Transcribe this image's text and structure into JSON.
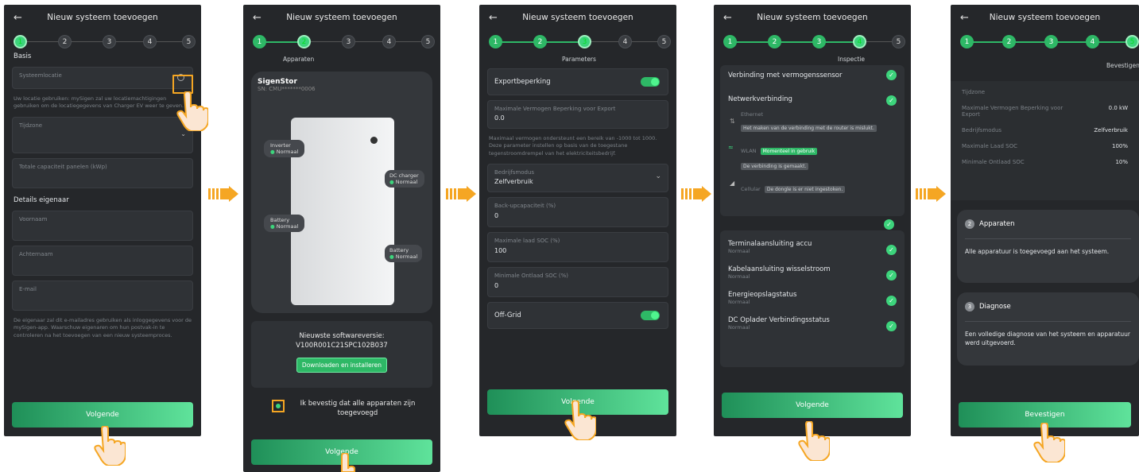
{
  "header_title": "Nieuw systeem toevoegen",
  "steps": [
    "1",
    "2",
    "3",
    "4",
    "5"
  ],
  "screen1": {
    "section_basis": "Basis",
    "field_location": "Systeemlocatie",
    "location_help": "Uw locatie gebruiken: mySigen zal uw locatiemachtigingen gebruiken om de locatiegegevens van Charger EV weer te geven.",
    "field_timezone": "Tijdzone",
    "field_capacity": "Totale capaciteit panelen (kWp)",
    "section_owner": "Details eigenaar",
    "field_firstname": "Voornaam",
    "field_lastname": "Achternaam",
    "field_email": "E-mail",
    "owner_help": "De eigenaar zal dit e-mailadres gebruiken als inloggegevens voor de mySigen-app. Waarschuw eigenaren om hun postvak-in te controleren na het toevoegen van een nieuw systeemproces.",
    "next": "Volgende"
  },
  "screen2": {
    "step_label": "Apparaten",
    "device_name": "SigenStor",
    "serial": "SN: CMU*******0006",
    "comp_inverter": "Inverter",
    "comp_inverter_status": "Normaal",
    "comp_dc": "DC charger",
    "comp_dc_status": "Normaal",
    "comp_battery1": "Battery",
    "comp_battery1_status": "Normaal",
    "comp_battery2": "Battery",
    "comp_battery2_status": "Normaal",
    "sw_title": "Nieuwste softwareversie:",
    "sw_version": "V100R001C21SPC102B037",
    "sw_button": "Downloaden en installeren",
    "confirm_text": "Ik bevestig dat alle apparaten zijn toegevoegd",
    "next": "Volgende"
  },
  "screen3": {
    "step_label": "Parameters",
    "export_limit": "Exportbeperking",
    "max_export_label": "Maximale Vermogen Beperking voor Export",
    "max_export_value": "0.0",
    "max_export_help": "Maximaal vermogen ondersteunt een bereik van -1000 tot 1000. Deze parameter instellen op basis van de toegestane tegenstroomdrempel van het elektriciteitsbedrijf.",
    "mode_label": "Bedrijfsmodus",
    "mode_value": "Zelfverbruik",
    "backup_label": "Back-upcapaciteit (%)",
    "backup_value": "0",
    "maxsoc_label": "Maximale laad SOC (%)",
    "maxsoc_value": "100",
    "minsoc_label": "Minimale Ontlaad SOC (%)",
    "minsoc_value": "0",
    "offgrid": "Off-Grid",
    "next": "Volgende"
  },
  "screen4": {
    "step_label": "Inspectie",
    "item_sensor": "Verbinding met vermogenssensor",
    "item_network": "Netwerkverbinding",
    "ethernet": "Ethernet",
    "ethernet_msg": "Het maken van de verbinding met de router is mislukt.",
    "wlan": "WLAN",
    "wlan_badge": "Momenteel in gebruik",
    "wlan_msg": "De verbinding is gemaakt.",
    "cellular": "Cellular",
    "cellular_msg": "De dongle is er niet ingestoken.",
    "item_terminal": "Terminalaansluiting accu",
    "item_terminal_status": "Normaal",
    "item_ac": "Kabelaansluiting wisselstroom",
    "item_ac_status": "Normaal",
    "item_storage": "Energieopslagstatus",
    "item_storage_status": "Normaal",
    "item_dc": "DC Oplader Verbindingsstatus",
    "item_dc_status": "Normaal",
    "next": "Volgende"
  },
  "screen5": {
    "step_label": "Bevestigen",
    "tz_label": "Tijdzone",
    "max_label": "Maximale Vermogen Beperking voor Export",
    "max_value": "0.0 kW",
    "mode_label": "Bedrijfsmodus",
    "mode_value": "Zelfverbruik",
    "maxsoc_label": "Maximale Laad SOC",
    "maxsoc_value": "100%",
    "minsoc_label": "Minimale Ontlaad SOC",
    "minsoc_value": "10%",
    "sec2_num": "2",
    "sec2_title": "Apparaten",
    "sec2_text": "Alle apparatuur is toegevoegd aan het systeem.",
    "sec3_num": "3",
    "sec3_title": "Diagnose",
    "sec3_text": "Een volledige diagnose van het systeem en apparatuur werd uitgevoerd.",
    "confirm": "Bevestigen"
  }
}
